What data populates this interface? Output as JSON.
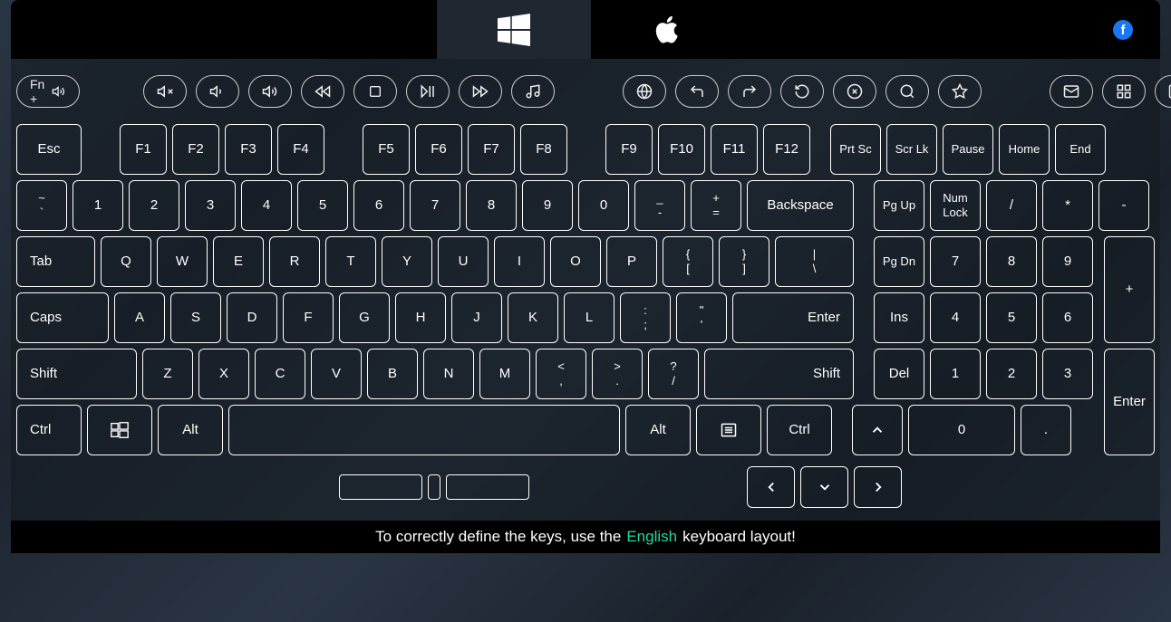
{
  "tabs": {
    "windows": "Windows",
    "apple": "Apple"
  },
  "fn_label": "Fn + ",
  "fn_icons": [
    "mute",
    "vol-down",
    "vol-up",
    "prev",
    "stop",
    "play-pause",
    "next",
    "music",
    "globe",
    "reply",
    "forward",
    "refresh",
    "close-circle",
    "search",
    "star",
    "mail",
    "dashboard",
    "folder"
  ],
  "row_func": {
    "esc": "Esc",
    "f1": "F1",
    "f2": "F2",
    "f3": "F3",
    "f4": "F4",
    "f5": "F5",
    "f6": "F6",
    "f7": "F7",
    "f8": "F8",
    "f9": "F9",
    "f10": "F10",
    "f11": "F11",
    "f12": "F12",
    "prtsc": "Prt Sc",
    "scrlk": "Scr Lk",
    "pause": "Pause",
    "home": "Home",
    "end": "End"
  },
  "row_num": {
    "tilde_top": "~",
    "tilde_bot": "`",
    "n1": "1",
    "n2": "2",
    "n3": "3",
    "n4": "4",
    "n5": "5",
    "n6": "6",
    "n7": "7",
    "n8": "8",
    "n9": "9",
    "n0": "0",
    "minus_top": "_",
    "minus_bot": "-",
    "eq_top": "+",
    "eq_bot": "=",
    "backspace": "Backspace",
    "pgup": "Pg Up",
    "numlock": "Num Lock",
    "slash": "/",
    "star": "*",
    "minus": "-"
  },
  "row_q": {
    "tab": "Tab",
    "q": "Q",
    "w": "W",
    "e": "E",
    "r": "R",
    "t": "T",
    "y": "Y",
    "u": "U",
    "i": "I",
    "o": "O",
    "p": "P",
    "lb_top": "{",
    "lb_bot": "[",
    "rb_top": "}",
    "rb_bot": "]",
    "bs_top": "|",
    "bs_bot": "\\",
    "pgdn": "Pg Dn",
    "np7": "7",
    "np8": "8",
    "np9": "9",
    "plus": "+"
  },
  "row_a": {
    "caps": "Caps",
    "a": "A",
    "s": "S",
    "d": "D",
    "f": "F",
    "g": "G",
    "h": "H",
    "j": "J",
    "k": "K",
    "l": "L",
    "sc_top": ":",
    "sc_bot": ";",
    "qt_top": "\"",
    "qt_bot": "'",
    "enter": "Enter",
    "ins": "Ins",
    "np4": "4",
    "np5": "5",
    "np6": "6"
  },
  "row_z": {
    "shift": "Shift",
    "z": "Z",
    "x": "X",
    "c": "C",
    "v": "V",
    "b": "B",
    "n": "N",
    "m": "M",
    "cm_top": "<",
    "cm_bot": ",",
    "pd_top": ">",
    "pd_bot": ".",
    "sl_top": "?",
    "sl_bot": "/",
    "rshift": "Shift",
    "del": "Del",
    "np1": "1",
    "np2": "2",
    "np3": "3",
    "npenter": "Enter"
  },
  "row_ctrl": {
    "ctrl": "Ctrl",
    "win": "Win",
    "alt": "Alt",
    "space": " ",
    "ralt": "Alt",
    "menu": "Menu",
    "rctrl": "Ctrl",
    "up": "↑",
    "np0": "0",
    "npdot": "."
  },
  "arrows": {
    "left": "←",
    "down": "↓",
    "right": "→"
  },
  "footer": {
    "pre": "To correctly define the keys, use the",
    "word": "English",
    "post": "keyboard layout!"
  }
}
